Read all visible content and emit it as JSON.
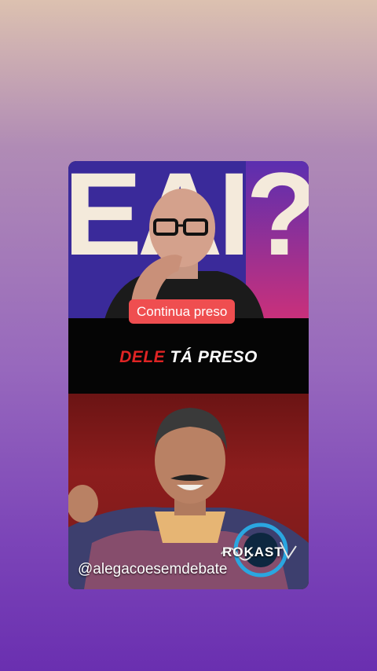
{
  "story": {
    "caption": "Continua preso",
    "headline_red": "DELE",
    "headline_white": "TÁ PRESO",
    "handle": "@alegacoesemdebate",
    "logo_text": "ROKAST",
    "backdrop_letters": "EAI?"
  },
  "colors": {
    "caption_bg": "#ef4e50",
    "headline_red": "#e02424",
    "band": "#050505"
  }
}
